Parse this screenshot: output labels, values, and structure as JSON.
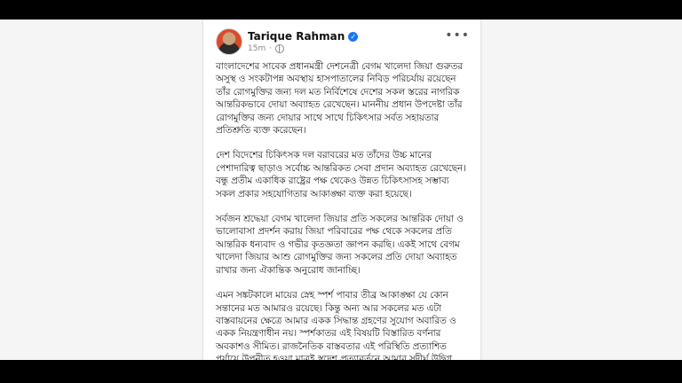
{
  "post": {
    "author": "Tarique Rahman",
    "verified_icon": "verified-badge-icon",
    "timestamp": "15m",
    "visibility_icon": "globe-icon",
    "more_icon": "more-options-icon",
    "more_label": "•••",
    "paragraphs": [
      "বাংলাদেশের সাবেক প্রধানমন্ত্রী দেশনেত্রী বেগম খালেদা জিয়া গুরুতর অসুস্থ ও সংকটাপন্ন অবস্থায় হাসপাতালের নিবিড় পরিচর্যায় রয়েছেন তাঁর রোগমুক্তির জন্য দল মত নির্বিশেষে দেশের সকল স্তরের নাগরিক আন্তরিকভাবে দোয়া অব্যাহত রেখেছেন। মাননীয় প্রধান উপদেষ্টা তাঁর রোগমুক্তির জন্য দোয়ার সাথে সাথে চিকিৎসার সর্বত সহায়তার প্রতিশ্রুতি ব্যক্ত করেছেন।",
      "দেশ বিদেশের চিকিৎসক দল বরাবরের মত তাঁদের উচ্চ মানের পেশাদারিত্ব ছাড়াও সর্বোচ্চ আন্তরিকত সেবা প্রদান অব্যাহত রেখেছেন। বন্ধু প্রতীম একাধিক রাষ্ট্রের পক্ষ থেকেও উন্নত চিকিৎসাসহ সম্ভাব্য সকল প্রকার সহযোগিতার আকাঙ্ক্ষা ব্যক্ত করা হয়েছে।",
      "সর্বজন শ্রদ্ধেয়া বেগম খালেদা জিয়ার প্রতি সকলের আন্তরিক দোয়া ও ভালোবাসা প্রদর্শন করায় জিয়া পরিবারের পক্ষ থেকে সকলের প্রতি আন্তরিক ধন্যবাদ ও গভীর কৃতজ্ঞতা জ্ঞাপন করছি। একই সাথে বেগম খালেদা জিয়ার আশু রোগমুক্তির জন্য সকলের প্রতি দোয়া অব্যাহত রাখার জন্য ঐকান্তিক অনুরোধ জানাচ্ছি।",
      "এমন সঙ্কটকালে মায়ের স্নেহ স্পর্শ পাবার তীব্র আকাঙ্ক্ষা যে কোন সন্তানের মত আমারও রয়েছে। কিন্তু অন্য আর সকলের মত এটা বাস্তবায়নের ক্ষেত্রে আমার একক সিদ্ধান্ত গ্রহণের সুযোগ অবারিত ও একক নিয়ন্ত্রণাধীন নয়। স্পর্শকাতর এই বিষয়টি বিস্তারিত বর্ণনার অবকাশও সীমিত। রাজনৈতিক বাস্তবতার এই পরিস্থিতি প্রত্যাশিত পর্যায়ে উপনীত হওয়া মাত্রই স্বদেশ প্রত্যাবর্তনে আমার সুদীর্ঘ উদ্বিগ্ন প্রতিক্ষার অবসান ঘটবে বলেই আমাদের পরিবার আশাবাদী।"
    ]
  }
}
